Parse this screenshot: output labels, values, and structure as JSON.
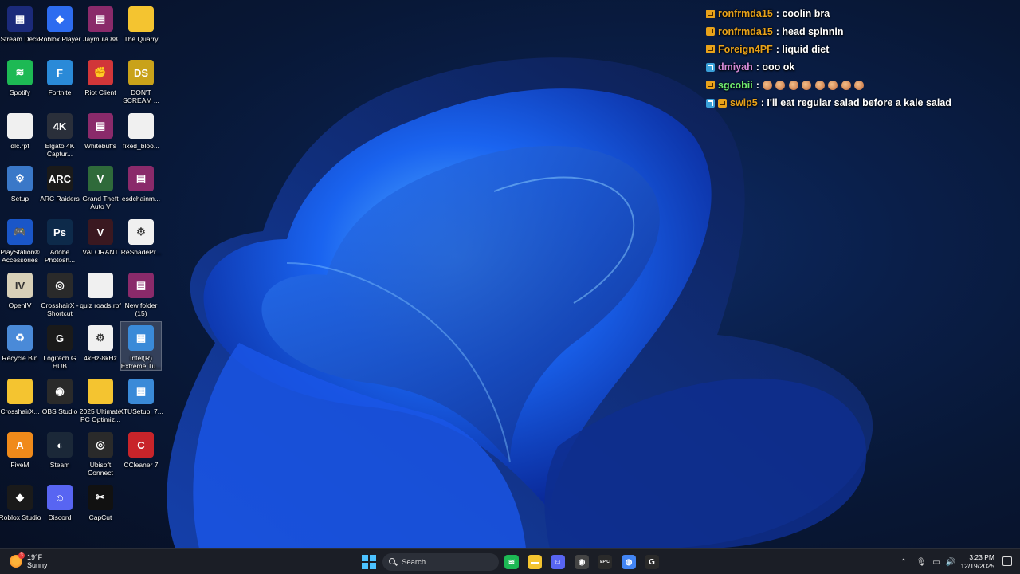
{
  "desktop": {
    "icons": [
      {
        "label": "Stream Deck",
        "color": "#1b2a7a",
        "glyph": "▦"
      },
      {
        "label": "Roblox Player",
        "color": "#2d6cf0",
        "glyph": "◆"
      },
      {
        "label": "Jaymula 88",
        "color": "#8a2a6a",
        "glyph": "▤"
      },
      {
        "label": "The.Quarry",
        "color": "#f4c430",
        "glyph": ""
      },
      {
        "label": "Spotify",
        "color": "#1db954",
        "glyph": "≋"
      },
      {
        "label": "Fortnite",
        "color": "#2a8ad8",
        "glyph": "F"
      },
      {
        "label": "Riot Client",
        "color": "#d13639",
        "glyph": "✊"
      },
      {
        "label": "DON'T SCREAM ...",
        "color": "#c9a21a",
        "glyph": "DS"
      },
      {
        "label": "dlc.rpf",
        "color": "#f0f0f0",
        "glyph": ""
      },
      {
        "label": "Elgato 4K Captur...",
        "color": "#2a2f3a",
        "glyph": "4K"
      },
      {
        "label": "Whitebuffs",
        "color": "#8a2a6a",
        "glyph": "▤"
      },
      {
        "label": "fixed_bloo...",
        "color": "#f0f0f0",
        "glyph": ""
      },
      {
        "label": "Setup",
        "color": "#3a78c8",
        "glyph": "⚙"
      },
      {
        "label": "ARC Raiders",
        "color": "#1a1a1a",
        "glyph": "ARC"
      },
      {
        "label": "Grand Theft Auto V",
        "color": "#2f6a3a",
        "glyph": "V"
      },
      {
        "label": "esdchainm...",
        "color": "#8a2a6a",
        "glyph": "▤"
      },
      {
        "label": "PlayStation® Accessories",
        "color": "#1a56c8",
        "glyph": "🎮"
      },
      {
        "label": "Adobe Photosh...",
        "color": "#0d2a4a",
        "glyph": "Ps"
      },
      {
        "label": "VALORANT",
        "color": "#3a1820",
        "glyph": "V"
      },
      {
        "label": "ReShadePr...",
        "color": "#f0f0f0",
        "glyph": "⚙"
      },
      {
        "label": "OpenIV",
        "color": "#d8d0b8",
        "glyph": "IV"
      },
      {
        "label": "CrosshairX - Shortcut",
        "color": "#2a2a2a",
        "glyph": "◎"
      },
      {
        "label": "quiz roads.rpf",
        "color": "#f0f0f0",
        "glyph": ""
      },
      {
        "label": "New folder (15)",
        "color": "#8a2a6a",
        "glyph": "▤"
      },
      {
        "label": "Recycle Bin",
        "color": "#4a8ad8",
        "glyph": "♻"
      },
      {
        "label": "Logitech G HUB",
        "color": "#1a1a1a",
        "glyph": "G"
      },
      {
        "label": "4kHz-8kHz",
        "color": "#f0f0f0",
        "glyph": "⚙"
      },
      {
        "label": "Intel(R) Extreme Tu...",
        "color": "#3a8ad8",
        "glyph": "▦"
      },
      {
        "label": "CrosshairX...",
        "color": "#f4c430",
        "glyph": ""
      },
      {
        "label": "OBS Studio",
        "color": "#2a2a2a",
        "glyph": "◉"
      },
      {
        "label": "2025 Ultimate PC Optimiz...",
        "color": "#f4c430",
        "glyph": ""
      },
      {
        "label": "XTUSetup_7...",
        "color": "#3a8ad8",
        "glyph": "▦"
      },
      {
        "label": "FiveM",
        "color": "#f08a1a",
        "glyph": "A"
      },
      {
        "label": "Steam",
        "color": "#1b2838",
        "glyph": "◐"
      },
      {
        "label": "Ubisoft Connect",
        "color": "#2a2a2a",
        "glyph": "◎"
      },
      {
        "label": "CCleaner 7",
        "color": "#c8242a",
        "glyph": "C"
      },
      {
        "label": "Roblox Studio",
        "color": "#1a1a1a",
        "glyph": "◆"
      },
      {
        "label": "Discord",
        "color": "#5865f2",
        "glyph": "☺"
      },
      {
        "label": "CapCut",
        "color": "#111111",
        "glyph": "✂"
      }
    ]
  },
  "chat": {
    "messages": [
      {
        "badges": [
          "crown"
        ],
        "user": "ronfrmda15",
        "user_color": "#e8a21a",
        "text": ": coolin bra",
        "emotes": 0
      },
      {
        "badges": [
          "crown"
        ],
        "user": "ronfrmda15",
        "user_color": "#e8a21a",
        "text": ": head spinnin",
        "emotes": 0
      },
      {
        "badges": [
          "crown"
        ],
        "user": "Foreign4PF",
        "user_color": "#e8a21a",
        "text": ": liquid diet",
        "emotes": 0
      },
      {
        "badges": [
          "sub"
        ],
        "user": "dmiyah",
        "user_color": "#d58bd8",
        "text": ": ooo ok",
        "emotes": 0
      },
      {
        "badges": [
          "crown"
        ],
        "user": "sgcobii",
        "user_color": "#6ee86e",
        "text": ":",
        "emotes": 8
      },
      {
        "badges": [
          "sub",
          "crown"
        ],
        "user": "swip5",
        "user_color": "#e8a21a",
        "text": ": I'll eat regular salad before a kale salad",
        "emotes": 0
      }
    ]
  },
  "taskbar": {
    "weather": {
      "temp": "19°F",
      "condition": "Sunny",
      "alert": "3"
    },
    "search_placeholder": "Search",
    "apps": [
      {
        "name": "spotify",
        "color": "#1db954",
        "glyph": "≋"
      },
      {
        "name": "file-explorer",
        "color": "#f4c430",
        "glyph": "▬"
      },
      {
        "name": "discord",
        "color": "#5865f2",
        "glyph": "☺"
      },
      {
        "name": "obs",
        "color": "#444",
        "glyph": "◉"
      },
      {
        "name": "epic-games",
        "color": "#2a2a2a",
        "glyph": "EPIC"
      },
      {
        "name": "chrome",
        "color": "#4285f4",
        "glyph": "◍"
      },
      {
        "name": "g-app",
        "color": "#2a2a2a",
        "glyph": "G"
      }
    ],
    "clock": {
      "time": "3:23 PM",
      "date": "12/19/2025"
    }
  }
}
